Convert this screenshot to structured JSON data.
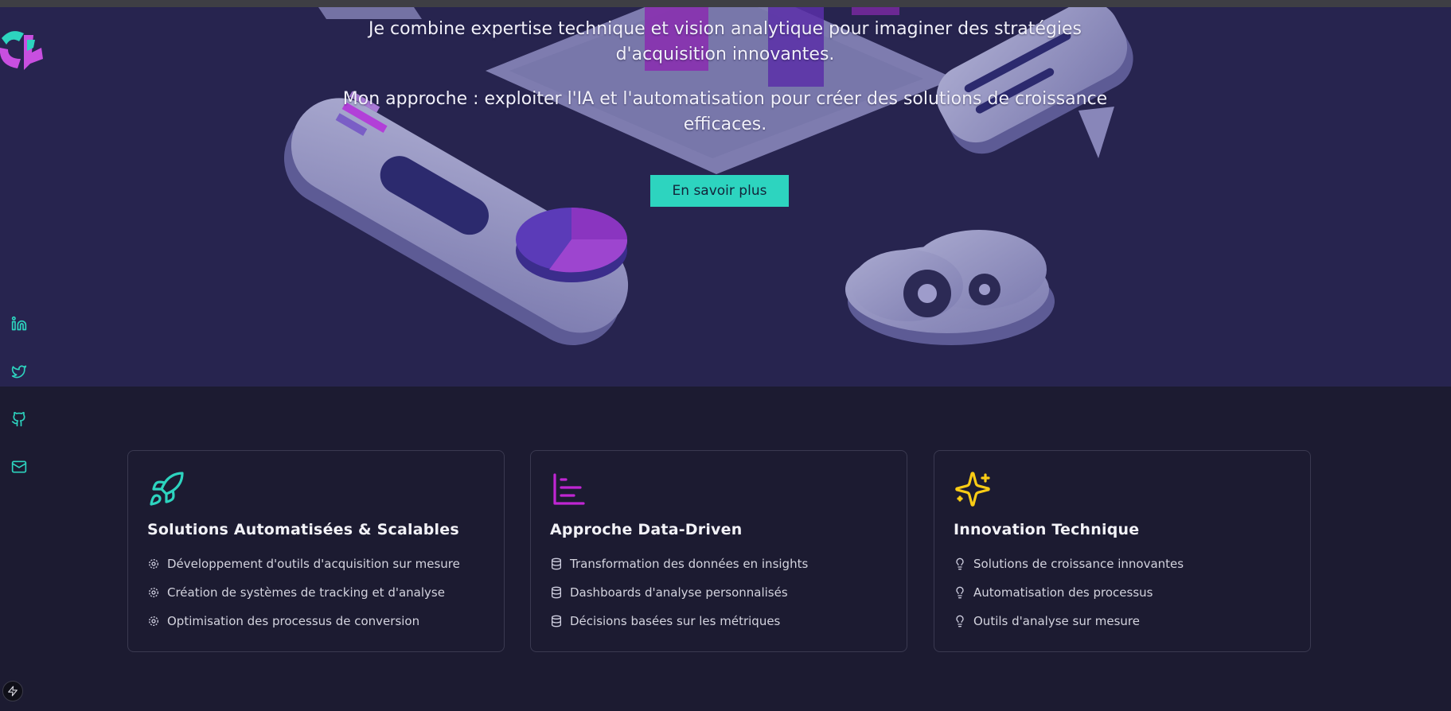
{
  "hero": {
    "paragraph1": "Je combine expertise technique et vision analytique pour imaginer des stratégies d'acquisition innovantes.",
    "paragraph2": "Mon approche : exploiter l'IA et l'automatisation pour créer des solutions de croissance efficaces.",
    "cta_label": "En savoir plus"
  },
  "social": {
    "icons": [
      "linkedin-icon",
      "twitter-icon",
      "github-icon",
      "mail-icon"
    ]
  },
  "colors": {
    "accent_teal": "#2dd4bf",
    "accent_purple": "#c026d3",
    "accent_yellow": "#facc15",
    "hero_bg": "#27244f",
    "page_bg": "#1c1b31"
  },
  "cards": [
    {
      "icon": "rocket-icon",
      "title": "Solutions Automatisées & Scalables",
      "item_icon": "gear-icon",
      "items": [
        "Développement d'outils d'acquisition sur mesure",
        "Création de systèmes de tracking et d'analyse",
        "Optimisation des processus de conversion"
      ]
    },
    {
      "icon": "bar-chart-icon",
      "title": "Approche Data-Driven",
      "item_icon": "database-icon",
      "items": [
        "Transformation des données en insights",
        "Dashboards d'analyse personnalisés",
        "Décisions basées sur les métriques"
      ]
    },
    {
      "icon": "sparkles-icon",
      "title": "Innovation Technique",
      "item_icon": "lightbulb-icon",
      "items": [
        "Solutions de croissance innovantes",
        "Automatisation des processus",
        "Outils d'analyse sur mesure"
      ]
    }
  ]
}
